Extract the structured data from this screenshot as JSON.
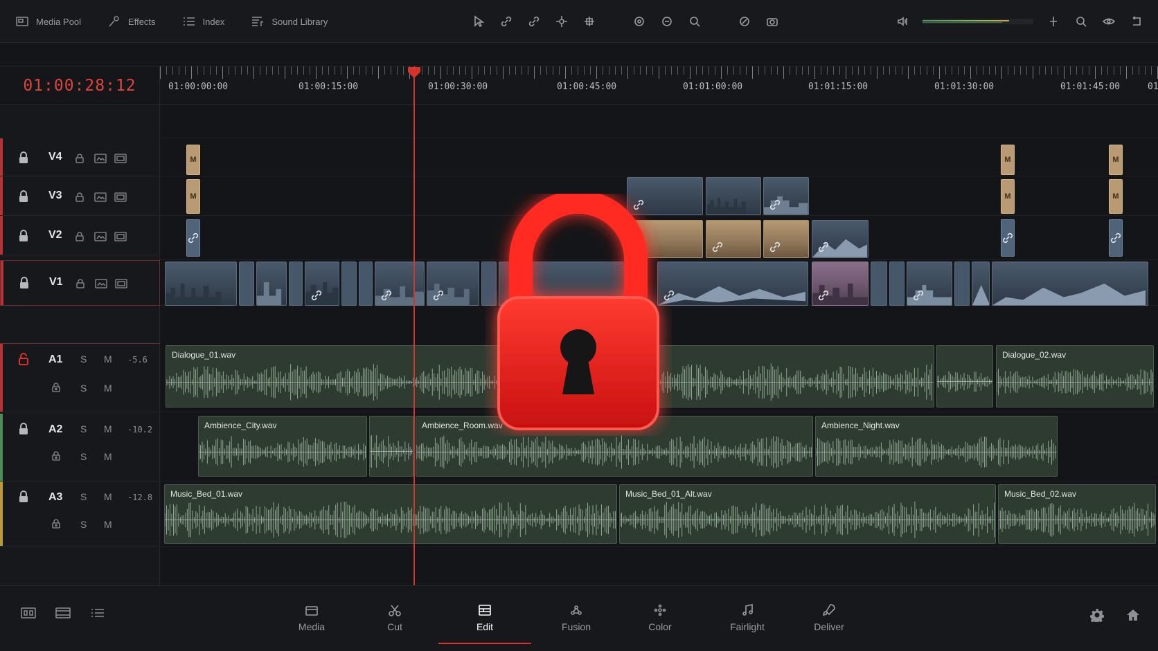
{
  "toolbar": {
    "media_pool": "Media Pool",
    "effects": "Effects",
    "index": "Index",
    "sound_library": "Sound Library"
  },
  "timecode": "01:00:28:12",
  "ruler": {
    "labels": [
      "01:00:00:00",
      "01:00:15:00",
      "01:00:30:00",
      "01:00:45:00",
      "01:01:00:00",
      "01:01:15:00",
      "01:01:30:00",
      "01:01:45:00",
      "01"
    ]
  },
  "video_tracks": [
    {
      "name": "V4",
      "strip_color": "#b5343a"
    },
    {
      "name": "V3",
      "strip_color": "#b5343a"
    },
    {
      "name": "V2",
      "strip_color": "#b5343a"
    },
    {
      "name": "V1",
      "strip_color": "#b5343a"
    }
  ],
  "audio_tracks": [
    {
      "name": "A1",
      "volume": "-5.6",
      "solo": "S",
      "mute": "M",
      "strip_color": "#b5343a"
    },
    {
      "name": "A2",
      "volume": "-10.2",
      "solo": "S",
      "mute": "M",
      "strip_color": "#4f8a5a"
    },
    {
      "name": "A3",
      "volume": "-12.8",
      "solo": "S",
      "mute": "M",
      "strip_color": "#b99a3a"
    }
  ],
  "marker_label": "M",
  "audio_clips": {
    "dialogue_01": "Dialogue_01.wav",
    "dialogue_02": "Dialogue_02.wav",
    "ambience_city": "Ambience_City.wav",
    "ambience_room": "Ambience_Room.wav",
    "ambience_night": "Ambience_Night.wav",
    "music_bed_01": "Music_Bed_01.wav",
    "music_bed_01_alt": "Music_Bed_01_Alt.wav",
    "music_bed_02": "Music_Bed_02.wav"
  },
  "pages": {
    "media": "Media",
    "cut": "Cut",
    "edit": "Edit",
    "fusion": "Fusion",
    "color": "Color",
    "fairlight": "Fairlight",
    "deliver": "Deliver",
    "active": "Edit"
  },
  "colors": {
    "accent": "#d8322c",
    "lock_overlay": "#e01b1b",
    "audio_clip": "#2e3b30",
    "video_clip": "#46576a"
  },
  "audio_meter_level": 0.78
}
